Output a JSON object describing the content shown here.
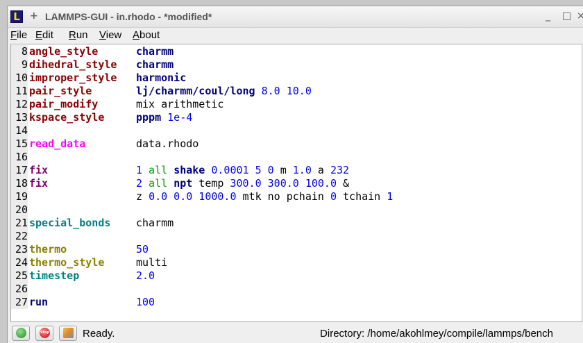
{
  "window": {
    "title": "LAMMPS-GUI - in.rhodo - *modified*",
    "app_icon_letter": "L",
    "minimize": "_",
    "maximize": "□",
    "close": "×"
  },
  "menu": {
    "file": {
      "mnemonic": "F",
      "rest": "ile"
    },
    "edit": {
      "mnemonic": "E",
      "rest": "dit"
    },
    "run": {
      "mnemonic": "R",
      "rest": "un"
    },
    "view": {
      "mnemonic": "V",
      "rest": "iew"
    },
    "about": {
      "mnemonic": "A",
      "rest": "bout"
    }
  },
  "colors": {
    "dark_red": "#8b0000",
    "navy": "#00007f",
    "blue": "#0000ee",
    "magenta": "#ff00ff",
    "purple": "#7a0072",
    "teal": "#008080",
    "olive": "#8b8000",
    "green": "#00a000"
  },
  "editor": {
    "lines": [
      {
        "n": "8",
        "cmd": "angle_style",
        "cmd_color": "#8b0000",
        "args": [
          {
            "t": "charmm",
            "c": "#00007f",
            "b": true
          }
        ]
      },
      {
        "n": "9",
        "cmd": "dihedral_style",
        "cmd_color": "#8b0000",
        "args": [
          {
            "t": "charmm",
            "c": "#00007f",
            "b": true
          }
        ]
      },
      {
        "n": "10",
        "cmd": "improper_style",
        "cmd_color": "#8b0000",
        "args": [
          {
            "t": "harmonic",
            "c": "#00007f",
            "b": true
          }
        ]
      },
      {
        "n": "11",
        "cmd": "pair_style",
        "cmd_color": "#8b0000",
        "args": [
          {
            "t": "lj/charmm/coul/long",
            "c": "#00007f",
            "b": true
          },
          {
            "t": " 8.0 10.0",
            "c": "#0000ee"
          }
        ]
      },
      {
        "n": "12",
        "cmd": "pair_modify",
        "cmd_color": "#8b0000",
        "args": [
          {
            "t": "mix arithmetic",
            "c": "#000000"
          }
        ]
      },
      {
        "n": "13",
        "cmd": "kspace_style",
        "cmd_color": "#8b0000",
        "args": [
          {
            "t": "pppm",
            "c": "#00007f",
            "b": true
          },
          {
            "t": " 1e-4",
            "c": "#0000ee"
          }
        ]
      },
      {
        "n": "14",
        "cmd": "",
        "args": []
      },
      {
        "n": "15",
        "cmd": "read_data",
        "cmd_color": "#ff00ff",
        "args": [
          {
            "t": "data.rhodo",
            "c": "#000000"
          }
        ]
      },
      {
        "n": "16",
        "cmd": "",
        "args": []
      },
      {
        "n": "17",
        "cmd": "fix",
        "cmd_color": "#7a0072",
        "args": [
          {
            "t": "1",
            "c": "#0000ee"
          },
          {
            "t": " all ",
            "c": "#00a000"
          },
          {
            "t": "shake",
            "c": "#00007f",
            "b": true
          },
          {
            "t": " 0.0001 5 0 ",
            "c": "#0000ee"
          },
          {
            "t": "m ",
            "c": "#000000"
          },
          {
            "t": "1.0",
            "c": "#0000ee"
          },
          {
            "t": " a ",
            "c": "#000000"
          },
          {
            "t": "232",
            "c": "#0000ee"
          }
        ]
      },
      {
        "n": "18",
        "cmd": "fix",
        "cmd_color": "#7a0072",
        "args": [
          {
            "t": "2",
            "c": "#0000ee"
          },
          {
            "t": " all ",
            "c": "#00a000"
          },
          {
            "t": "npt",
            "c": "#00007f",
            "b": true
          },
          {
            "t": " temp ",
            "c": "#000000"
          },
          {
            "t": "300.0 300.0 100.0",
            "c": "#0000ee"
          },
          {
            "t": " &",
            "c": "#000000"
          }
        ]
      },
      {
        "n": "19",
        "cmd": "",
        "args": [
          {
            "t": "z ",
            "c": "#000000"
          },
          {
            "t": "0.0 0.0 1000.0",
            "c": "#0000ee"
          },
          {
            "t": " mtk no pchain ",
            "c": "#000000"
          },
          {
            "t": "0",
            "c": "#0000ee"
          },
          {
            "t": " tchain ",
            "c": "#000000"
          },
          {
            "t": "1",
            "c": "#0000ee"
          }
        ]
      },
      {
        "n": "20",
        "cmd": "",
        "args": []
      },
      {
        "n": "21",
        "cmd": "special_bonds",
        "cmd_color": "#008080",
        "args": [
          {
            "t": "charmm",
            "c": "#000000"
          }
        ]
      },
      {
        "n": "22",
        "cmd": "",
        "args": []
      },
      {
        "n": "23",
        "cmd": "thermo",
        "cmd_color": "#8b8000",
        "args": [
          {
            "t": "50",
            "c": "#0000ee"
          }
        ]
      },
      {
        "n": "24",
        "cmd": "thermo_style",
        "cmd_color": "#8b8000",
        "args": [
          {
            "t": "multi",
            "c": "#000000"
          }
        ]
      },
      {
        "n": "25",
        "cmd": "timestep",
        "cmd_color": "#008080",
        "args": [
          {
            "t": "2.0",
            "c": "#0000ee"
          }
        ]
      },
      {
        "n": "26",
        "cmd": "",
        "args": []
      },
      {
        "n": "27",
        "cmd": "run",
        "cmd_color": "#00007f",
        "args": [
          {
            "t": "100",
            "c": "#0000ee"
          }
        ]
      }
    ]
  },
  "status": {
    "run_button_icon": "run-icon",
    "stop_button_icon": "stop-icon",
    "stop_label": "Stop",
    "vis_button_icon": "visualize-icon",
    "ready_text": "Ready.",
    "directory_text": "Directory: /home/akohlmey/compile/lammps/bench"
  }
}
